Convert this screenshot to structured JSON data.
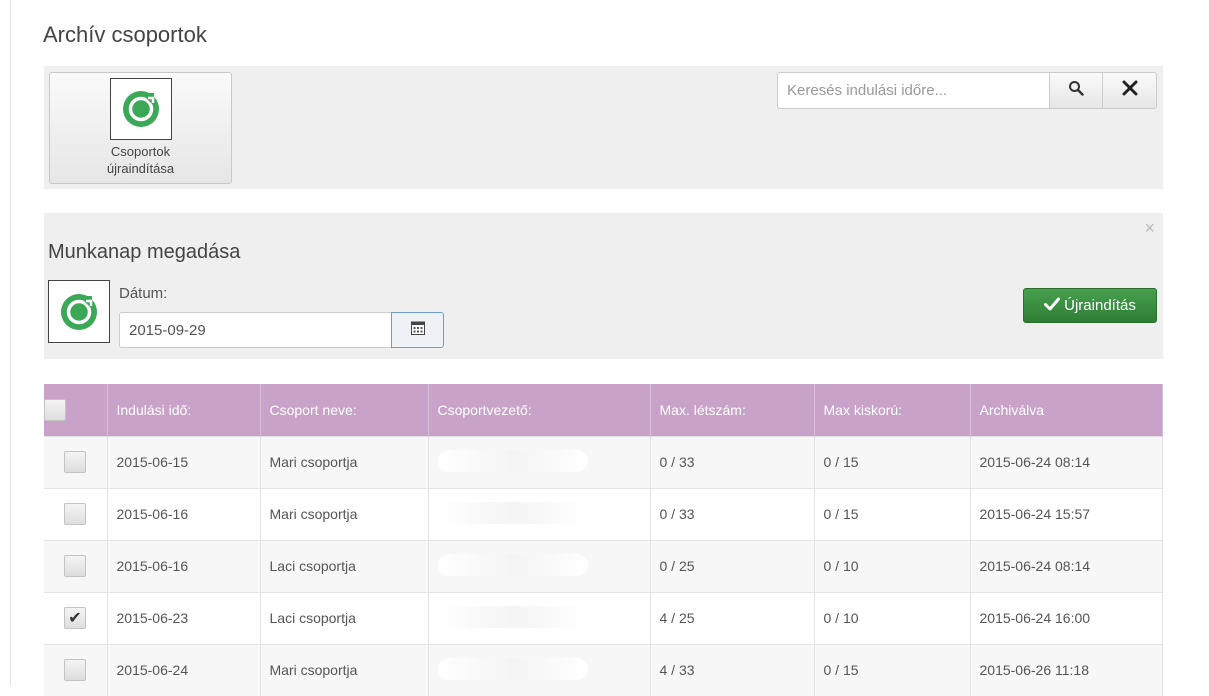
{
  "page": {
    "title": "Archív csoportok"
  },
  "toolbar": {
    "restart_groups_line1": "Csoportok",
    "restart_groups_line2": "újraindítása",
    "search_placeholder": "Keresés indulási időre...",
    "search_icon": "search-icon",
    "clear_icon": "close-icon"
  },
  "panel": {
    "title": "Munkanap megadása",
    "date_label": "Dátum:",
    "date_value": "2015-09-29",
    "restart_label": "Újraindítás"
  },
  "table": {
    "headers": [
      "Indulási idő:",
      "Csoport neve:",
      "Csoportvezető:",
      "Max. létszám:",
      "Max kiskorú:",
      "Archiválva"
    ],
    "rows": [
      {
        "checked": false,
        "start": "2015-06-15",
        "group": "Mari csoportja",
        "leader": "",
        "max_people": "0 / 33",
        "max_minors": "0 / 15",
        "archived": "2015-06-24 08:14"
      },
      {
        "checked": false,
        "start": "2015-06-16",
        "group": "Mari csoportja",
        "leader": "",
        "max_people": "0 / 33",
        "max_minors": "0 / 15",
        "archived": "2015-06-24 15:57"
      },
      {
        "checked": false,
        "start": "2015-06-16",
        "group": "Laci csoportja",
        "leader": "",
        "max_people": "0 / 25",
        "max_minors": "0 / 10",
        "archived": "2015-06-24 08:14"
      },
      {
        "checked": true,
        "start": "2015-06-23",
        "group": "Laci csoportja",
        "leader": "",
        "max_people": "4 / 25",
        "max_minors": "0 / 10",
        "archived": "2015-06-24 16:00"
      },
      {
        "checked": false,
        "start": "2015-06-24",
        "group": "Mari csoportja",
        "leader": "",
        "max_people": "4 / 33",
        "max_minors": "0 / 15",
        "archived": "2015-06-26 11:18"
      }
    ]
  },
  "colors": {
    "header_bg": "#c8a2c8",
    "success": "#3a8f40",
    "icon_green": "#3aa856"
  }
}
